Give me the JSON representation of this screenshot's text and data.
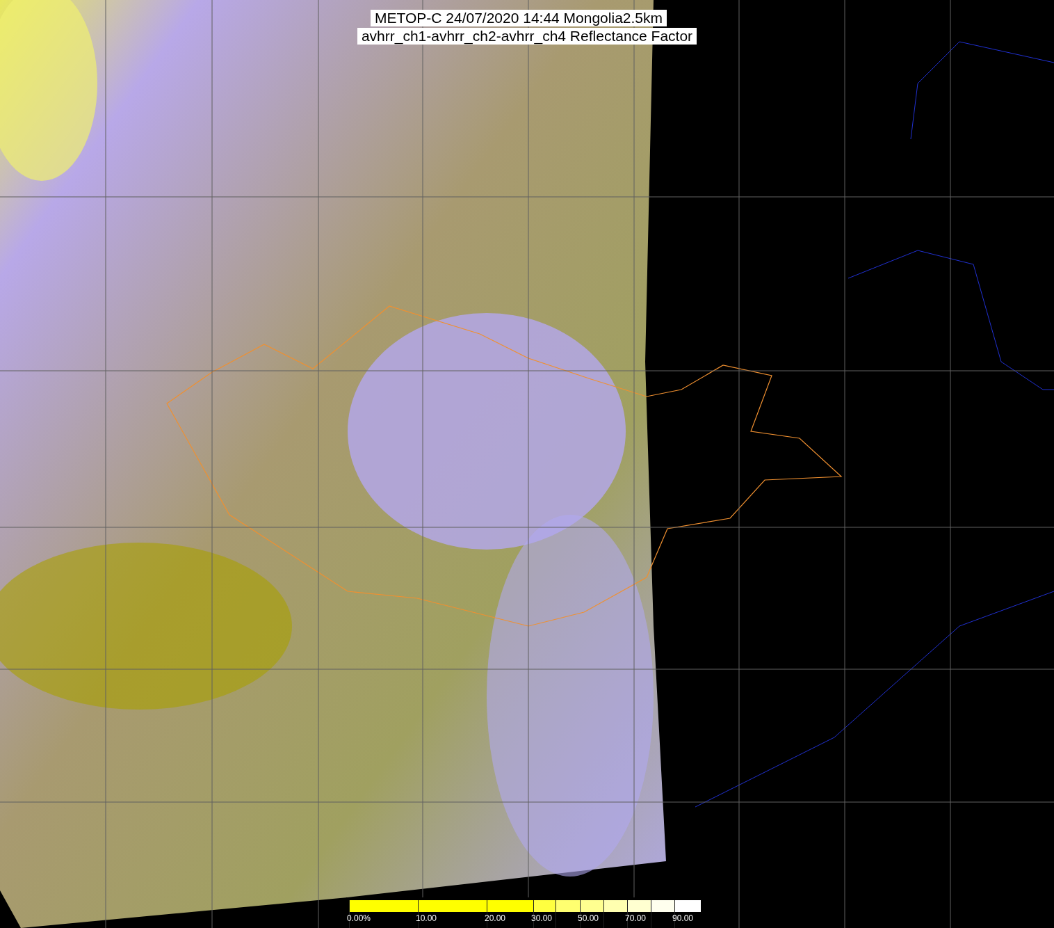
{
  "title": {
    "lines": [
      "METOP-C 24/07/2020 14:44 Mongolia2.5km",
      "avhrr_ch1-avhrr_ch2-avhrr_ch4 Reflectance Factor"
    ]
  },
  "colorbar": {
    "segments": [
      {
        "color": "#ffff00",
        "tick": "0.00%"
      },
      {
        "color": "#ffff00",
        "tick": "10.00"
      },
      {
        "color": "#ffff00",
        "tick": "20.00"
      },
      {
        "color": "#ffff40",
        "tick": "30.00"
      },
      {
        "color": "#ffff70"
      },
      {
        "color": "#ffff90",
        "tick": "50.00"
      },
      {
        "color": "#ffffb0"
      },
      {
        "color": "#ffffd0",
        "tick": "70.00"
      },
      {
        "color": "#ffffee"
      },
      {
        "color": "#ffffff",
        "tick": "90.00"
      }
    ]
  }
}
